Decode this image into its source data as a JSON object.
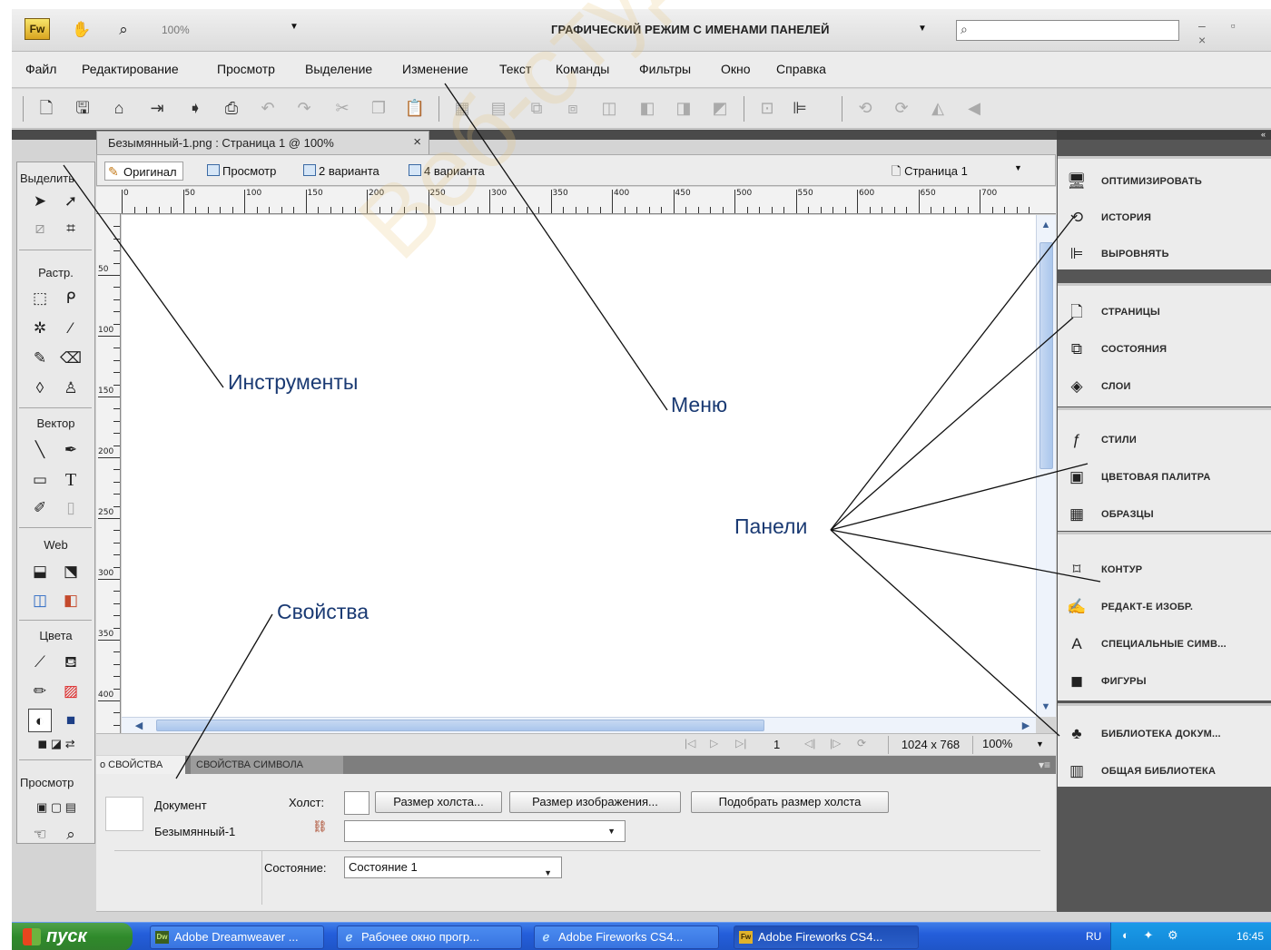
{
  "appbar": {
    "logo": "Fw",
    "zoom": "100%",
    "workspace": "ГРАФИЧЕСКИЙ РЕЖИМ С ИМЕНАМИ ПАНЕЛЕЙ",
    "window_controls": "– ▫ ×"
  },
  "menu": [
    "Файл",
    "Редактирование",
    "Просмотр",
    "Выделение",
    "Изменение",
    "Текст",
    "Команды",
    "Фильтры",
    "Окно",
    "Справка"
  ],
  "document": {
    "tab_title": "Безымянный-1.png : Страница 1 @ 100%",
    "views": [
      "Оригинал",
      "Просмотр",
      "2 варианта",
      "4 варианта"
    ],
    "page_select": "Страница 1",
    "ruler_h": [
      "0",
      "50",
      "100",
      "150",
      "200",
      "250",
      "300",
      "350",
      "400",
      "450",
      "500",
      "550",
      "600",
      "650",
      "700"
    ],
    "ruler_v": [
      "50",
      "100",
      "150",
      "200",
      "250",
      "300",
      "350",
      "400"
    ]
  },
  "tools": {
    "sections": [
      "Выделить",
      "Растр.",
      "Вектор",
      "Web",
      "Цвета",
      "Просмотр"
    ]
  },
  "status": {
    "page": "1",
    "size": "1024 x 768",
    "zoom": "100%"
  },
  "properties": {
    "tab_active": "о СВОЙСТВА",
    "tab_symbol": "СВОЙСТВА СИМВОЛА",
    "doc_type": "Документ",
    "doc_name": "Безымянный-1",
    "canvas_label": "Холст:",
    "btn_canvas_size": "Размер холста...",
    "btn_image_size": "Размер изображения...",
    "btn_fit_canvas": "Подобрать размер холста",
    "state_label": "Состояние:",
    "state_value": "Состояние 1"
  },
  "panels": {
    "groups": [
      [
        "ОПТИМИЗИРОВАТЬ",
        "ИСТОРИЯ",
        "ВЫРОВНЯТЬ"
      ],
      [
        "СТРАНИЦЫ",
        "СОСТОЯНИЯ",
        "СЛОИ"
      ],
      [
        "СТИЛИ",
        "ЦВЕТОВАЯ ПАЛИТРА",
        "ОБРАЗЦЫ"
      ],
      [
        "КОНТУР",
        "РЕДАКТ-Е ИЗОБР.",
        "СПЕЦИАЛЬНЫЕ СИМВ...",
        "ФИГУРЫ"
      ],
      [
        "БИБЛИОТЕКА ДОКУМ...",
        "ОБЩАЯ БИБЛИОТЕКА"
      ]
    ]
  },
  "taskbar": {
    "start": "пуск",
    "buttons": [
      "Adobe Dreamweaver ...",
      "Рабочее окно прогр...",
      "Adobe Fireworks CS4...",
      "Adobe Fireworks CS4..."
    ],
    "lang": "RU",
    "time": "16:45"
  },
  "annotations": {
    "tools": "Инструменты",
    "menu": "Меню",
    "panels": "Панели",
    "properties": "Свойства"
  },
  "watermark": "Веб-студия"
}
